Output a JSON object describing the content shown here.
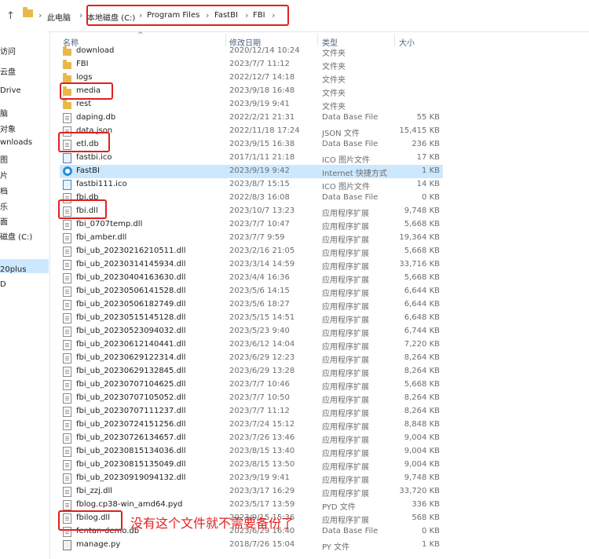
{
  "address_bar": {
    "crumbs": [
      "此电脑",
      "本地磁盘 (C:)",
      "Program Files",
      "FastBI",
      "FBI"
    ]
  },
  "nav_pane": {
    "items": [
      "访问",
      "云盘",
      "Drive",
      "脑",
      "对象",
      "wnloads",
      "图",
      "片",
      "档",
      "乐",
      "面",
      "磁盘 (C:)",
      "20plus",
      "D"
    ]
  },
  "columns": {
    "name": "名称",
    "modified": "修改日期",
    "type": "类型",
    "size": "大小"
  },
  "files": [
    {
      "name": "download",
      "date": "2020/12/14 10:24",
      "type": "文件夹",
      "size": "",
      "icon": "folder-icon"
    },
    {
      "name": "FBI",
      "date": "2023/7/7 11:12",
      "type": "文件夹",
      "size": "",
      "icon": "folder-icon"
    },
    {
      "name": "logs",
      "date": "2022/12/7 14:18",
      "type": "文件夹",
      "size": "",
      "icon": "folder-icon"
    },
    {
      "name": "media",
      "date": "2023/9/18 16:48",
      "type": "文件夹",
      "size": "",
      "icon": "folder-icon"
    },
    {
      "name": "rest",
      "date": "2023/9/19 9:41",
      "type": "文件夹",
      "size": "",
      "icon": "folder-icon"
    },
    {
      "name": "daping.db",
      "date": "2022/2/21 21:31",
      "type": "Data Base File",
      "size": "55 KB",
      "icon": "file-icon"
    },
    {
      "name": "data.json",
      "date": "2022/11/18 17:24",
      "type": "JSON 文件",
      "size": "15,415 KB",
      "icon": "file-icon"
    },
    {
      "name": "etl.db",
      "date": "2023/9/15 16:38",
      "type": "Data Base File",
      "size": "236 KB",
      "icon": "file-icon"
    },
    {
      "name": "fastbi.ico",
      "date": "2017/1/11 21:18",
      "type": "ICO 图片文件",
      "size": "17 KB",
      "icon": "image-file-icon"
    },
    {
      "name": "FastBI",
      "date": "2023/9/19 9:42",
      "type": "Internet 快捷方式",
      "size": "1 KB",
      "icon": "internet-shortcut-icon"
    },
    {
      "name": "fastbi111.ico",
      "date": "2023/8/7 15:15",
      "type": "ICO 图片文件",
      "size": "14 KB",
      "icon": "image-file-icon"
    },
    {
      "name": "fbi.db",
      "date": "2022/8/3 16:08",
      "type": "Data Base File",
      "size": "0 KB",
      "icon": "file-icon"
    },
    {
      "name": "fbi.dll",
      "date": "2023/10/7 13:23",
      "type": "应用程序扩展",
      "size": "9,748 KB",
      "icon": "file-icon"
    },
    {
      "name": "fbi_0707temp.dll",
      "date": "2023/7/7 10:47",
      "type": "应用程序扩展",
      "size": "5,668 KB",
      "icon": "file-icon"
    },
    {
      "name": "fbi_amber.dll",
      "date": "2023/7/7 9:59",
      "type": "应用程序扩展",
      "size": "19,364 KB",
      "icon": "file-icon"
    },
    {
      "name": "fbi_ub_20230216210511.dll",
      "date": "2023/2/16 21:05",
      "type": "应用程序扩展",
      "size": "5,668 KB",
      "icon": "file-icon"
    },
    {
      "name": "fbi_ub_20230314145934.dll",
      "date": "2023/3/14 14:59",
      "type": "应用程序扩展",
      "size": "33,716 KB",
      "icon": "file-icon"
    },
    {
      "name": "fbi_ub_20230404163630.dll",
      "date": "2023/4/4 16:36",
      "type": "应用程序扩展",
      "size": "5,668 KB",
      "icon": "file-icon"
    },
    {
      "name": "fbi_ub_20230506141528.dll",
      "date": "2023/5/6 14:15",
      "type": "应用程序扩展",
      "size": "6,644 KB",
      "icon": "file-icon"
    },
    {
      "name": "fbi_ub_20230506182749.dll",
      "date": "2023/5/6 18:27",
      "type": "应用程序扩展",
      "size": "6,644 KB",
      "icon": "file-icon"
    },
    {
      "name": "fbi_ub_20230515145128.dll",
      "date": "2023/5/15 14:51",
      "type": "应用程序扩展",
      "size": "6,648 KB",
      "icon": "file-icon"
    },
    {
      "name": "fbi_ub_20230523094032.dll",
      "date": "2023/5/23 9:40",
      "type": "应用程序扩展",
      "size": "6,744 KB",
      "icon": "file-icon"
    },
    {
      "name": "fbi_ub_20230612140441.dll",
      "date": "2023/6/12 14:04",
      "type": "应用程序扩展",
      "size": "7,220 KB",
      "icon": "file-icon"
    },
    {
      "name": "fbi_ub_20230629122314.dll",
      "date": "2023/6/29 12:23",
      "type": "应用程序扩展",
      "size": "8,264 KB",
      "icon": "file-icon"
    },
    {
      "name": "fbi_ub_20230629132845.dll",
      "date": "2023/6/29 13:28",
      "type": "应用程序扩展",
      "size": "8,264 KB",
      "icon": "file-icon"
    },
    {
      "name": "fbi_ub_20230707104625.dll",
      "date": "2023/7/7 10:46",
      "type": "应用程序扩展",
      "size": "5,668 KB",
      "icon": "file-icon"
    },
    {
      "name": "fbi_ub_20230707105052.dll",
      "date": "2023/7/7 10:50",
      "type": "应用程序扩展",
      "size": "8,264 KB",
      "icon": "file-icon"
    },
    {
      "name": "fbi_ub_20230707111237.dll",
      "date": "2023/7/7 11:12",
      "type": "应用程序扩展",
      "size": "8,264 KB",
      "icon": "file-icon"
    },
    {
      "name": "fbi_ub_20230724151256.dll",
      "date": "2023/7/24 15:12",
      "type": "应用程序扩展",
      "size": "8,848 KB",
      "icon": "file-icon"
    },
    {
      "name": "fbi_ub_20230726134657.dll",
      "date": "2023/7/26 13:46",
      "type": "应用程序扩展",
      "size": "9,004 KB",
      "icon": "file-icon"
    },
    {
      "name": "fbi_ub_20230815134036.dll",
      "date": "2023/8/15 13:40",
      "type": "应用程序扩展",
      "size": "9,004 KB",
      "icon": "file-icon"
    },
    {
      "name": "fbi_ub_20230815135049.dll",
      "date": "2023/8/15 13:50",
      "type": "应用程序扩展",
      "size": "9,004 KB",
      "icon": "file-icon"
    },
    {
      "name": "fbi_ub_20230919094132.dll",
      "date": "2023/9/19 9:41",
      "type": "应用程序扩展",
      "size": "9,748 KB",
      "icon": "file-icon"
    },
    {
      "name": "fbi_zzj.dll",
      "date": "2023/3/17 16:29",
      "type": "应用程序扩展",
      "size": "33,720 KB",
      "icon": "file-icon"
    },
    {
      "name": "fblog.cp38-win_amd64.pyd",
      "date": "2023/5/17 13:59",
      "type": "PYD 文件",
      "size": "336 KB",
      "icon": "file-icon"
    },
    {
      "name": "fbilog.dll",
      "date": "2023/9/15 15:36",
      "type": "应用程序扩展",
      "size": "568 KB",
      "icon": "file-icon"
    },
    {
      "name": "fentan-demo.db",
      "date": "2023/6/29 16:40",
      "type": "Data Base File",
      "size": "0 KB",
      "icon": "file-icon"
    },
    {
      "name": "manage.py",
      "date": "2018/7/26 15:04",
      "type": "PY 文件",
      "size": "1 KB",
      "icon": "python-file-icon"
    }
  ],
  "annotation": {
    "note": "没有这个文件就不需要备份了"
  },
  "colors": {
    "highlight_red": "#e02020",
    "selection_blue": "#cce8ff",
    "folder_yellow": "#e8b84b"
  }
}
